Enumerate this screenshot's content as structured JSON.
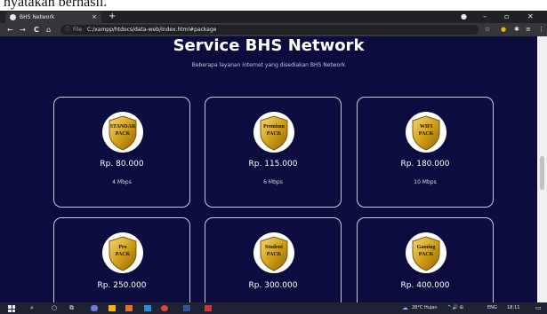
{
  "document_caption": "nyatakan berhasil.",
  "browser": {
    "tab_title": "BHS Network",
    "tab_close": "×",
    "new_tab": "+",
    "window_controls": {
      "minimize": "–",
      "maximize": "▫",
      "close": "✕"
    },
    "nav": {
      "back": "←",
      "forward": "→",
      "reload": "C",
      "home": "⌂"
    },
    "address_scheme": "File",
    "address_url": "C:/xampp/htdocs/data-web/index.html#package"
  },
  "page": {
    "title": "Service BHS Network",
    "subtitle": "Beberapa layanan internet yang disediakan BHS Network",
    "packages": [
      {
        "badge_line1": "STANDAR",
        "badge_line2": "PACK",
        "price": "Rp. 80.000",
        "speed": "4 Mbps"
      },
      {
        "badge_line1": "Premium",
        "badge_line2": "PACK",
        "price": "Rp. 115.000",
        "speed": "6 Mbps"
      },
      {
        "badge_line1": "WIFI",
        "badge_line2": "PACK",
        "price": "Rp. 180.000",
        "speed": "10 Mbps"
      },
      {
        "badge_line1": "Pro",
        "badge_line2": "PACK",
        "price": "Rp. 250.000",
        "speed": ""
      },
      {
        "badge_line1": "Student",
        "badge_line2": "PACK",
        "price": "Rp. 300.000",
        "speed": ""
      },
      {
        "badge_line1": "Gaming",
        "badge_line2": "PACK",
        "price": "Rp. 400.000",
        "speed": ""
      }
    ]
  },
  "taskbar": {
    "weather": "28°C Hujan",
    "tray_icons": "^ 🔊 ⊞",
    "language": "ENG",
    "time": "18:11"
  },
  "colors": {
    "page_background": "#0c0d3e",
    "card_border": "#c9c9d8",
    "shield_gold": "#d4a017",
    "browser_dark": "#202124"
  }
}
